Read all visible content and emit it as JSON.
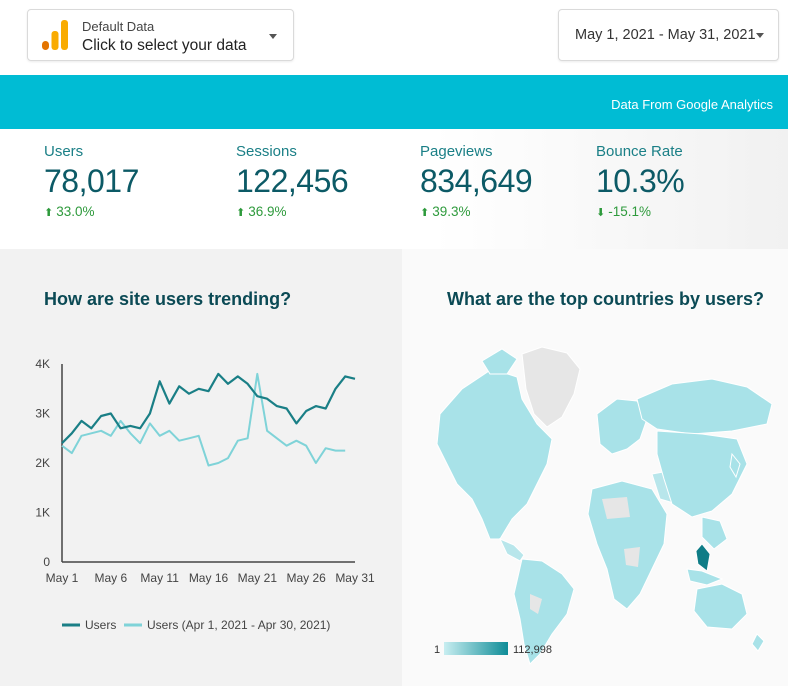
{
  "data_source": {
    "label": "Default Data",
    "value": "Click to select your data"
  },
  "date_range": {
    "value": "May 1, 2021 - May 31, 2021"
  },
  "banner": {
    "text": "Data From Google Analytics",
    "color": "#00bcd4"
  },
  "metrics": [
    {
      "label": "Users",
      "value": "78,017",
      "change": "33.0%",
      "direction": "up"
    },
    {
      "label": "Sessions",
      "value": "122,456",
      "change": "36.9%",
      "direction": "up"
    },
    {
      "label": "Pageviews",
      "value": "834,649",
      "change": "39.3%",
      "direction": "up"
    },
    {
      "label": "Bounce Rate",
      "value": "10.3%",
      "change": "-15.1%",
      "direction": "down"
    }
  ],
  "trend_panel": {
    "title": "How are site users trending?"
  },
  "map_panel": {
    "title": "What are the top countries by users?",
    "legend_min": "1",
    "legend_max": "112,998"
  },
  "chart_data": {
    "type": "line",
    "title": "How are site users trending?",
    "x_tick_labels": [
      "May 1",
      "May 6",
      "May 11",
      "May 16",
      "May 21",
      "May 26",
      "May 31"
    ],
    "y_tick_labels": [
      "0",
      "1K",
      "2K",
      "3K",
      "4K"
    ],
    "ylim": [
      0,
      4000
    ],
    "x": [
      1,
      2,
      3,
      4,
      5,
      6,
      7,
      8,
      9,
      10,
      11,
      12,
      13,
      14,
      15,
      16,
      17,
      18,
      19,
      20,
      21,
      22,
      23,
      24,
      25,
      26,
      27,
      28,
      29,
      30,
      31
    ],
    "series": [
      {
        "name": "Users",
        "color": "#1a7f86",
        "values": [
          2400,
          2600,
          2850,
          2700,
          2950,
          3000,
          2700,
          2750,
          2700,
          3000,
          3650,
          3200,
          3550,
          3400,
          3500,
          3450,
          3800,
          3600,
          3750,
          3600,
          3350,
          3300,
          3150,
          3100,
          2800,
          3050,
          3150,
          3100,
          3500,
          3750,
          3700
        ]
      },
      {
        "name": "Users (Apr 1, 2021 - Apr 30, 2021)",
        "color": "#7fd3d8",
        "values": [
          2350,
          2200,
          2550,
          2600,
          2650,
          2550,
          2850,
          2600,
          2400,
          2800,
          2550,
          2650,
          2450,
          2500,
          2550,
          1950,
          2000,
          2100,
          2450,
          2500,
          3800,
          2650,
          2500,
          2350,
          2450,
          2350,
          2000,
          2300,
          2250,
          2250,
          null
        ]
      }
    ],
    "legend_position": "bottom",
    "grid": false
  }
}
